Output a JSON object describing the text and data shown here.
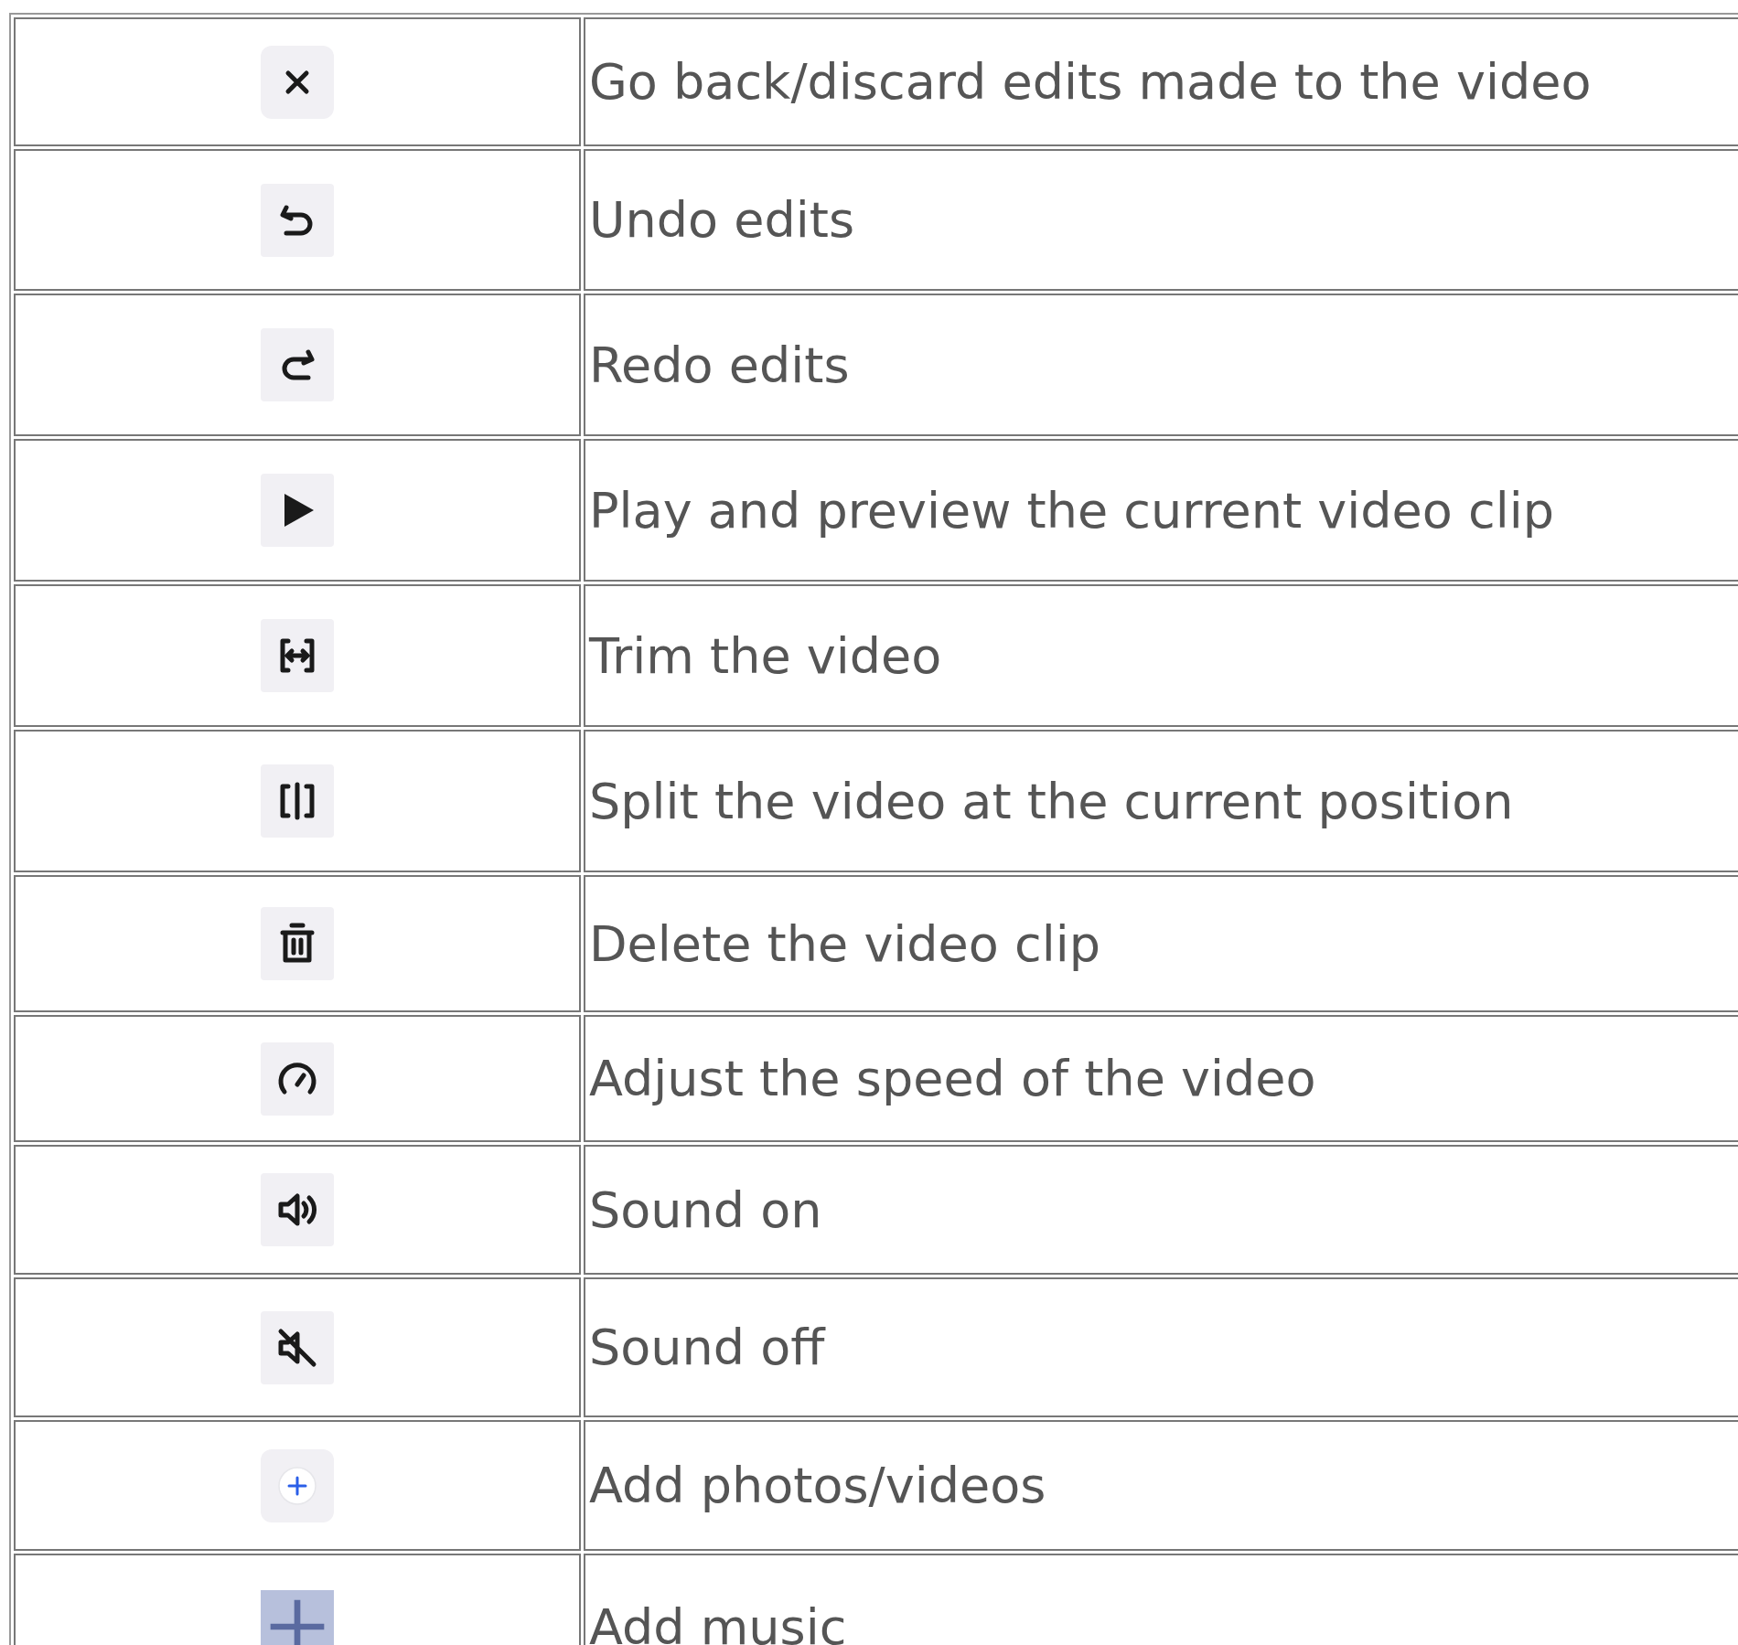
{
  "table": {
    "rows": [
      {
        "icon": {
          "kind": "close"
        },
        "description": "Go back/discard edits made to the video"
      },
      {
        "icon": {
          "kind": "undo"
        },
        "description": "Undo edits"
      },
      {
        "icon": {
          "kind": "redo"
        },
        "description": "Redo edits"
      },
      {
        "icon": {
          "kind": "play"
        },
        "description": "Play and preview the current video clip"
      },
      {
        "icon": {
          "kind": "trim"
        },
        "description": "Trim the video"
      },
      {
        "icon": {
          "kind": "split"
        },
        "description": "Split the video at the current position"
      },
      {
        "icon": {
          "kind": "delete"
        },
        "description": "Delete the video clip"
      },
      {
        "icon": {
          "kind": "speed"
        },
        "description": "Adjust the speed of the video"
      },
      {
        "icon": {
          "kind": "sound-on"
        },
        "description": "Sound on"
      },
      {
        "icon": {
          "kind": "sound-off"
        },
        "description": "Sound off"
      },
      {
        "icon": {
          "kind": "add-photos"
        },
        "description": "Add photos/videos"
      },
      {
        "icon": {
          "kind": "add-music"
        },
        "description": "Add music"
      }
    ]
  }
}
